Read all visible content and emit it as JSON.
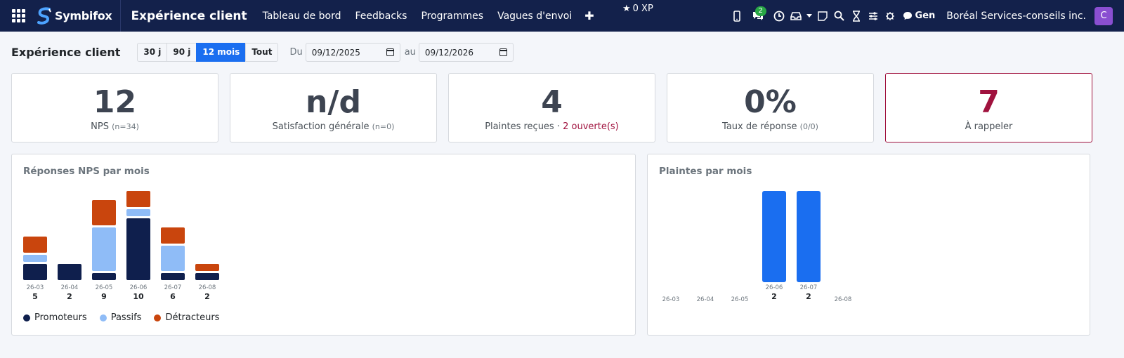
{
  "navbar": {
    "brand": "Symbifox",
    "app_title": "Expérience client",
    "menu": [
      "Tableau de bord",
      "Feedbacks",
      "Programmes",
      "Vagues d'envoi"
    ],
    "xp": "0 XP",
    "chat_badge": "2",
    "gen_label": "Gen",
    "company": "Boréal Services-conseils inc.",
    "avatar_initial": "C"
  },
  "filters": {
    "title": "Expérience client",
    "periods": [
      "30 j",
      "90 j",
      "12 mois",
      "Tout"
    ],
    "active_period": "12 mois",
    "from_label": "Du",
    "from_value": "09/12/2025",
    "to_label": "au",
    "to_value": "09/12/2026"
  },
  "kpis": [
    {
      "value": "12",
      "label": "NPS",
      "sub": "(n=34)"
    },
    {
      "value": "n/d",
      "label": "Satisfaction générale",
      "sub": "(n=0)"
    },
    {
      "value": "4",
      "label": "Plaintes reçues · ",
      "highlight": "2 ouverte(s)"
    },
    {
      "value": "0%",
      "label": "Taux de réponse",
      "sub": "(0/0)"
    },
    {
      "value": "7",
      "label": "À rappeler"
    }
  ],
  "colors": {
    "promoters": "#0f1f4d",
    "passives": "#8fbcf7",
    "detractors": "#c9450d",
    "complaints": "#1a6ef0",
    "accent_red": "#a0123e"
  },
  "chart_data": [
    {
      "type": "bar",
      "title": "Réponses NPS par mois",
      "categories": [
        "26-03",
        "26-04",
        "26-05",
        "26-06",
        "26-07",
        "26-08"
      ],
      "totals": [
        5,
        2,
        9,
        10,
        6,
        2
      ],
      "series": [
        {
          "name": "Promoteurs",
          "values": [
            2,
            2,
            1,
            7,
            1,
            1
          ]
        },
        {
          "name": "Passifs",
          "values": [
            1,
            0,
            5,
            1,
            3,
            0
          ]
        },
        {
          "name": "Détracteurs",
          "values": [
            2,
            0,
            3,
            2,
            2,
            1
          ]
        }
      ]
    },
    {
      "type": "bar",
      "title": "Plaintes par mois",
      "categories": [
        "26-03",
        "26-04",
        "26-05",
        "26-06",
        "26-07",
        "26-08"
      ],
      "values": [
        0,
        0,
        0,
        2,
        2,
        0
      ]
    }
  ]
}
